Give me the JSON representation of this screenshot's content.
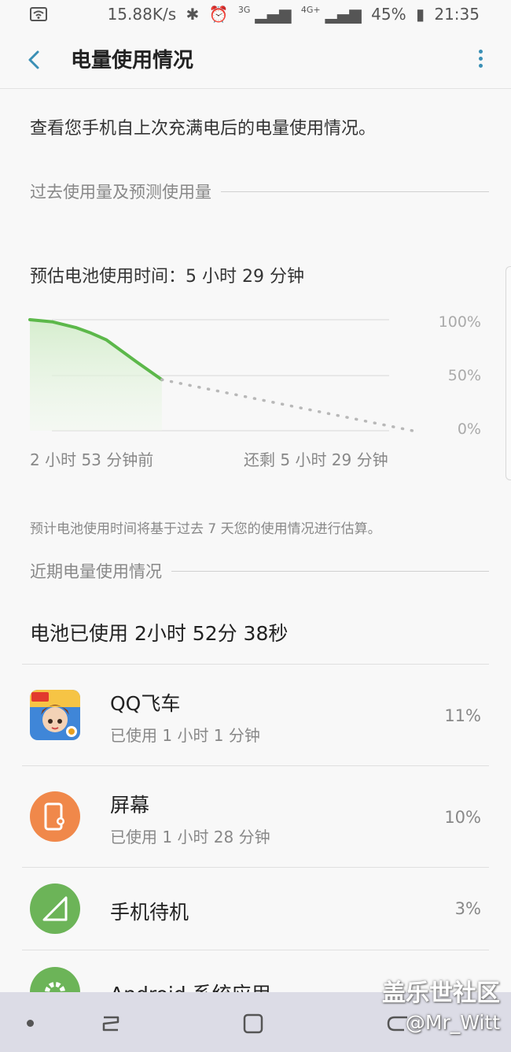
{
  "status_bar": {
    "speed": "15.88K/s",
    "net1": "3G",
    "net2": "4G+",
    "battery": "45%",
    "time": "21:35"
  },
  "app_bar": {
    "title": "电量使用情况"
  },
  "intro": "查看您手机自上次充满电后的电量使用情况。",
  "section_forecast": {
    "title": "过去使用量及预测使用量"
  },
  "estimate_text": "预估电池使用时间：5 小时 29 分钟",
  "chart_data": {
    "type": "line",
    "title": "",
    "xlabel": "",
    "ylabel": "",
    "x_labels": [
      "2 小时 53 分钟前",
      "还剩 5 小时 29 分钟"
    ],
    "y_ticks": [
      "100%",
      "50%",
      "0%"
    ],
    "ylim": [
      0,
      100
    ],
    "grid": true,
    "series": [
      {
        "style": "solid",
        "color": "#5cb84a",
        "x_minutes": [
          0,
          30,
          60,
          80,
          100,
          120,
          140,
          173
        ],
        "values": [
          100,
          98,
          93,
          88,
          82,
          72,
          62,
          46
        ]
      },
      {
        "style": "dotted",
        "color": "#b8b8b8",
        "x_minutes": [
          173,
          502
        ],
        "values": [
          46,
          0
        ]
      }
    ]
  },
  "footnote": "预计电池使用时间将基于过去 7 天您的使用情况进行估算。",
  "section_recent": {
    "title": "近期电量使用情况"
  },
  "total_used": "电池已使用 2小时 52分 38秒",
  "apps": [
    {
      "name": "QQ飞车",
      "sub": "已使用 1 小时 1 分钟",
      "pct": "11%",
      "icon": "qq-speed-app-icon"
    },
    {
      "name": "屏幕",
      "sub": "已使用 1 小时 28 分钟",
      "pct": "10%",
      "icon": "screen-icon",
      "color": "#f0884a"
    },
    {
      "name": "手机待机",
      "sub": "",
      "pct": "3%",
      "icon": "signal-standby-icon",
      "color": "#6cb458"
    },
    {
      "name": "Android 系统应用",
      "sub": "",
      "pct": "",
      "icon": "gear-icon",
      "color": "#6cb458"
    }
  ],
  "watermark": {
    "title": "盖乐世社区",
    "handle": "@Mr_Witt"
  }
}
